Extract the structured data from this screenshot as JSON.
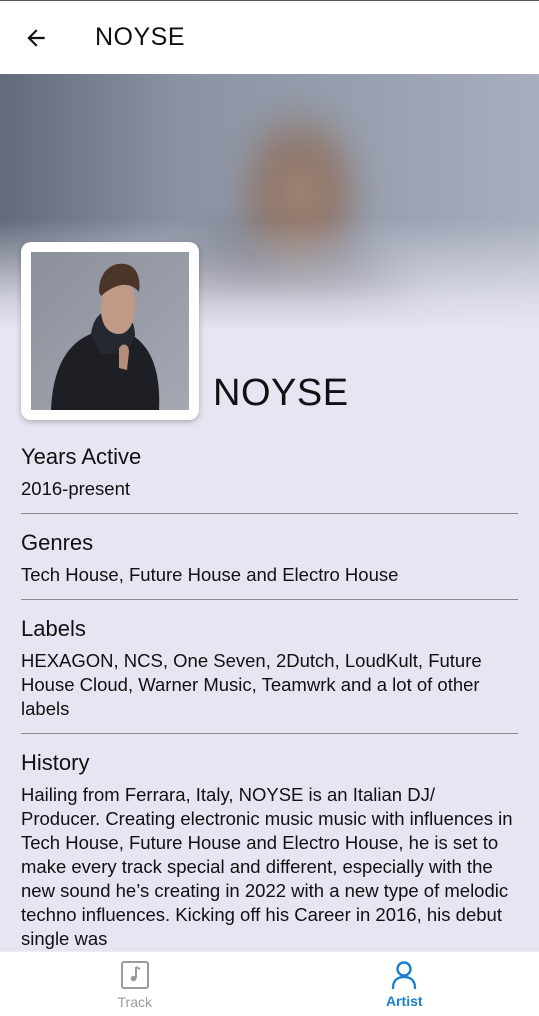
{
  "app_bar": {
    "title": "NOYSE"
  },
  "artist": {
    "name": "NOYSE"
  },
  "sections": {
    "years_active": {
      "title": "Years Active",
      "text": "2016-present"
    },
    "genres": {
      "title": "Genres",
      "text": "Tech House, Future House and Electro House"
    },
    "labels": {
      "title": "Labels",
      "text": "HEXAGON, NCS, One Seven, 2Dutch, LoudKult, Future House Cloud, Warner Music, Teamwrk and a lot of other labels"
    },
    "history": {
      "title": "History",
      "text": "Hailing from Ferrara, Italy, NOYSE is an Italian DJ/ Producer. Creating electronic music music with influences in Tech House, Future House and Electro House, he is set to make every track special and different, especially with the new sound he’s creating in 2022 with a new type of melodic techno influences. Kicking off his Career in 2016, his debut single was"
    }
  },
  "bottom_nav": {
    "items": [
      {
        "label": "Track",
        "icon": "music-note-icon",
        "active": false
      },
      {
        "label": "Artist",
        "icon": "person-icon",
        "active": true
      }
    ]
  },
  "colors": {
    "accent": "#1b7fd0",
    "background": "#e6e5f2",
    "inactive": "#9a9a9a"
  }
}
